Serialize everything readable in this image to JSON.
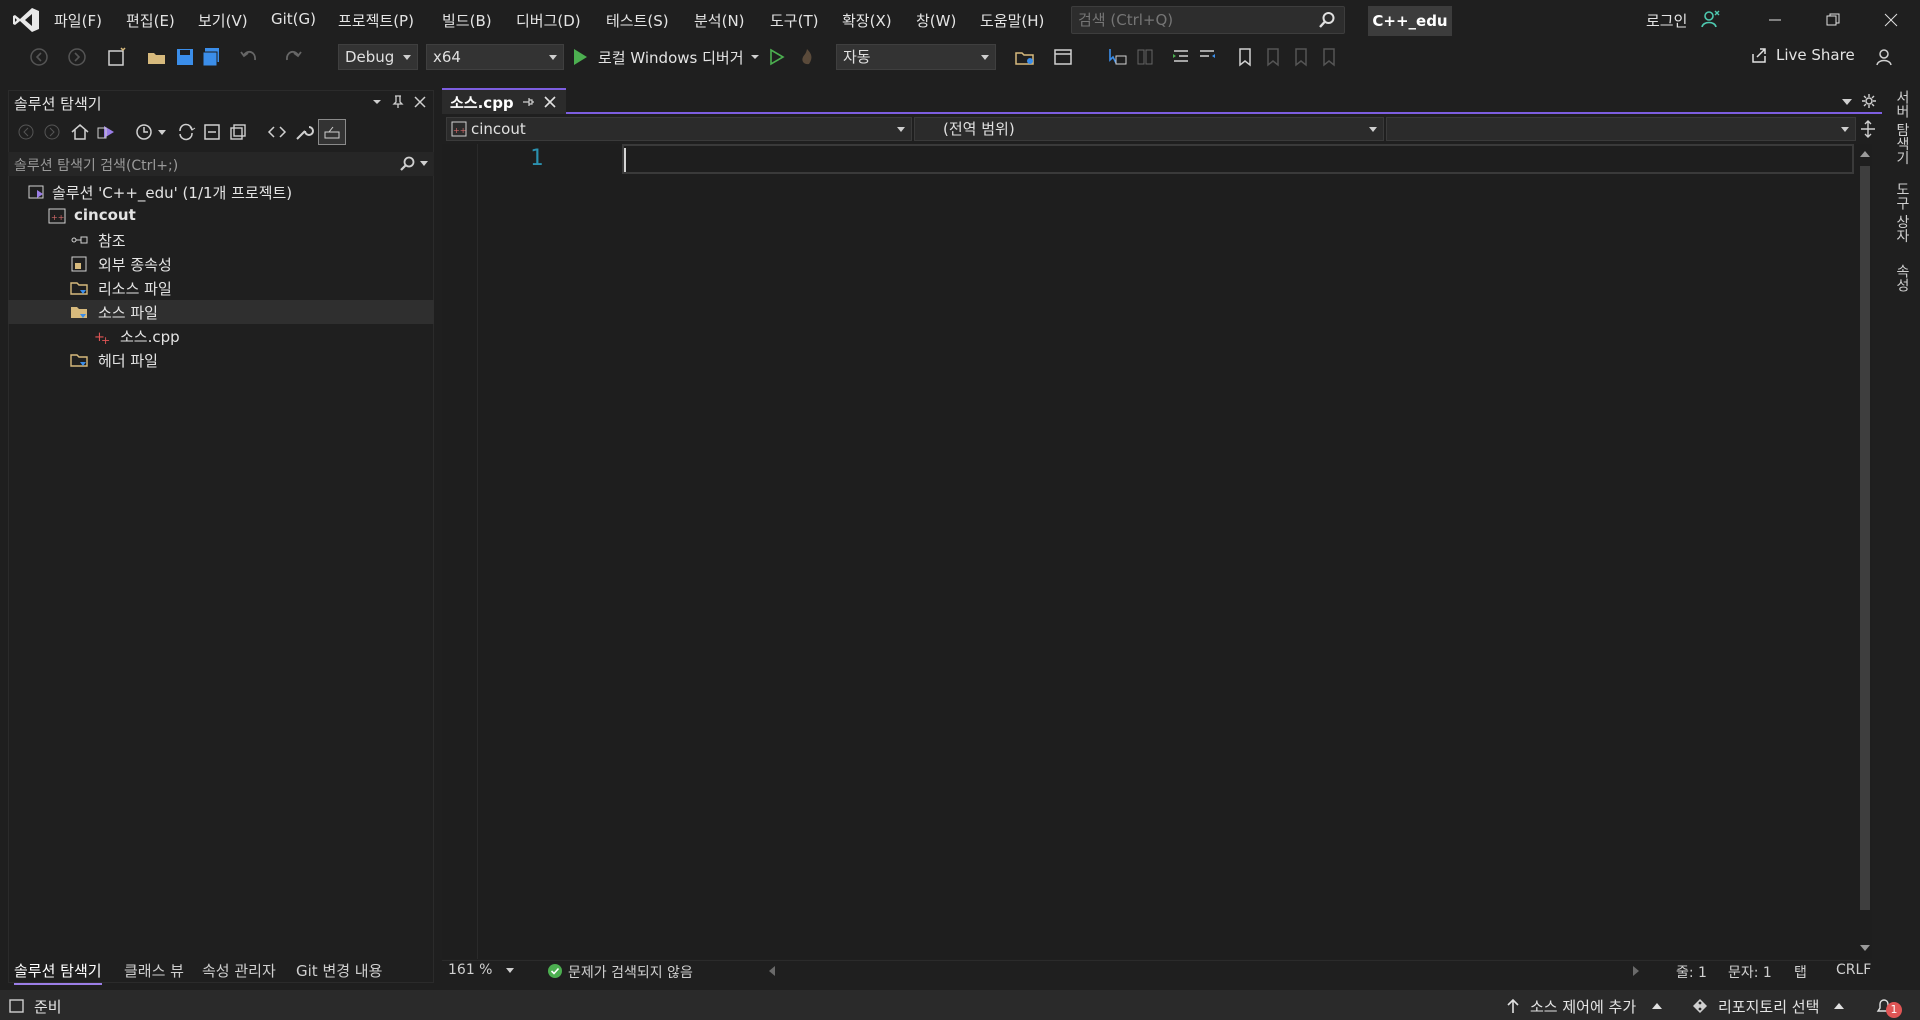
{
  "menu": {
    "items": [
      "파일(F)",
      "편집(E)",
      "보기(V)",
      "Git(G)",
      "프로젝트(P)",
      "빌드(B)",
      "디버그(D)",
      "테스트(S)",
      "분석(N)",
      "도구(T)",
      "확장(X)",
      "창(W)",
      "도움말(H)"
    ]
  },
  "search": {
    "placeholder": "검색 (Ctrl+Q)"
  },
  "project_badge": "C++_edu",
  "login": "로그인",
  "toolbar": {
    "config": "Debug",
    "platform": "x64",
    "run_label": "로컬 Windows 디버거",
    "auto": "자동",
    "live_share": "Live Share"
  },
  "solution_explorer": {
    "title": "솔루션 탐색기",
    "search_placeholder": "솔루션 탐색기 검색(Ctrl+;)",
    "solution": "솔루션 'C++_edu' (1/1개 프로젝트)",
    "project": "cincout",
    "nodes": [
      "참조",
      "외부 종속성",
      "리소스 파일",
      "소스 파일",
      "소스.cpp",
      "헤더 파일"
    ]
  },
  "bottom_tabs": [
    "솔루션 탐색기",
    "클래스 뷰",
    "속성 관리자",
    "Git 변경 내용"
  ],
  "editor": {
    "tab": "소스.cpp",
    "nav_project": "cincout",
    "nav_scope": "(전역 범위)",
    "nav_member": "",
    "line_number": "1"
  },
  "editor_status": {
    "zoom": "161 %",
    "issues": "문제가 검색되지 않음",
    "line": "줄: 1",
    "char": "문자: 1",
    "tab": "탭",
    "eol": "CRLF"
  },
  "side_panel": [
    "서버 탐색기",
    "도구 상자",
    "속성"
  ],
  "statusbar": {
    "ready": "준비",
    "source_control": "소스 제어에 추가",
    "repo": "리포지토리 선택",
    "notifications": "1"
  },
  "colors": {
    "accent": "#7d5ee0",
    "line_number": "#2b91af",
    "run_green": "#4caf50"
  }
}
